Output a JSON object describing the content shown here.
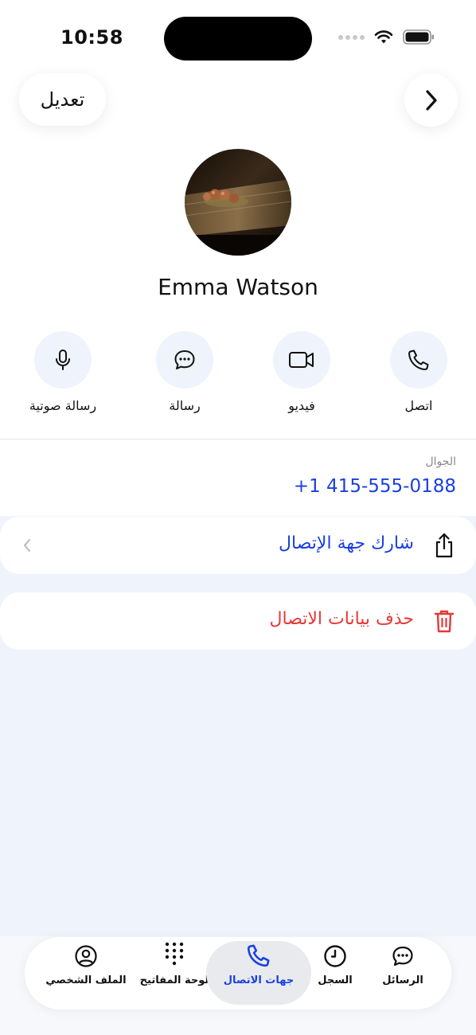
{
  "status_bar": {
    "time": "10:58"
  },
  "header": {
    "edit_label": "تعديل"
  },
  "contact": {
    "name": "Emma Watson"
  },
  "actions": [
    {
      "label": "رسالة صوتية",
      "icon": "mic-icon"
    },
    {
      "label": "رسالة",
      "icon": "message-bubble-icon"
    },
    {
      "label": "فيديو",
      "icon": "video-camera-icon"
    },
    {
      "label": "اتصل",
      "icon": "phone-icon"
    }
  ],
  "mobile": {
    "label": "الجوال",
    "number": "+1 415-555-0188"
  },
  "share": {
    "label": "شارك جهة الإتصال"
  },
  "delete": {
    "label": "حذف بيانات الاتصال"
  },
  "tabs": [
    {
      "label": "الملف الشخصي",
      "icon": "profile-icon"
    },
    {
      "label": "لوحة المفاتيح",
      "icon": "keypad-icon"
    },
    {
      "label": "جهات الاتصال",
      "icon": "phone-icon",
      "active": true
    },
    {
      "label": "السجل",
      "icon": "clock-icon"
    },
    {
      "label": "الرسائل",
      "icon": "chat-bubble-icon"
    }
  ],
  "colors": {
    "accent": "#1a3fe0",
    "danger": "#e53935",
    "background": "#eef3fc"
  }
}
